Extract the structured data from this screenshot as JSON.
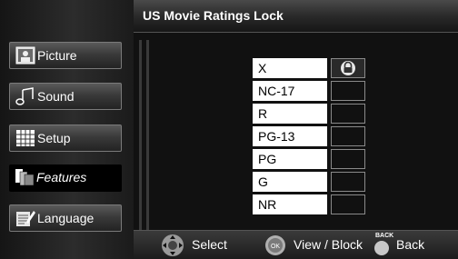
{
  "header": {
    "title": "US Movie Ratings Lock"
  },
  "sidebar": {
    "items": [
      {
        "label": "Picture",
        "icon": "picture-icon",
        "active": false
      },
      {
        "label": "Sound",
        "icon": "music-note-icon",
        "active": false
      },
      {
        "label": "Setup",
        "icon": "grid-icon",
        "active": false
      },
      {
        "label": "Features",
        "icon": "features-icon",
        "active": true
      },
      {
        "label": "Language",
        "icon": "language-icon",
        "active": false
      }
    ]
  },
  "ratings": [
    {
      "label": "X",
      "locked": true
    },
    {
      "label": "NC-17",
      "locked": false
    },
    {
      "label": "R",
      "locked": false
    },
    {
      "label": "PG-13",
      "locked": false
    },
    {
      "label": "PG",
      "locked": false
    },
    {
      "label": "G",
      "locked": false
    },
    {
      "label": "NR",
      "locked": false
    }
  ],
  "footer": {
    "select_label": "Select",
    "ok_button": "OK",
    "view_block_label": "View / Block",
    "back_button": "BACK",
    "back_label": "Back"
  }
}
